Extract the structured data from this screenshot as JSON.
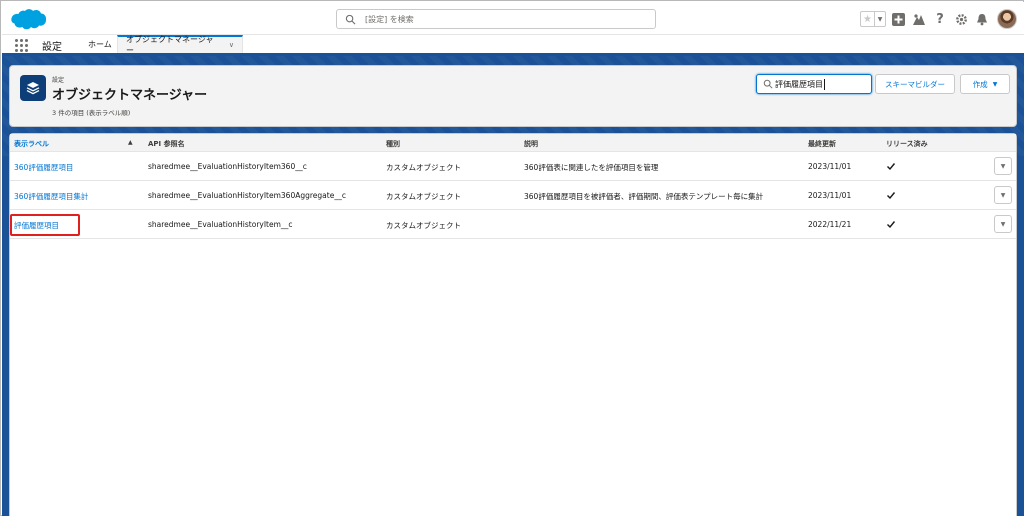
{
  "header": {
    "search_placeholder": "[設定] を検索",
    "brand_color": "#00a1e0",
    "icons": [
      "favorite-star-icon",
      "favorites-dropdown-icon",
      "add-icon",
      "trailhead-icon",
      "help-icon",
      "setup-gear-icon",
      "notifications-bell-icon",
      "user-avatar"
    ]
  },
  "context_bar": {
    "app_name": "設定",
    "tabs": [
      {
        "label": "ホーム"
      },
      {
        "label": "オブジェクトマネージャー"
      }
    ]
  },
  "page_header": {
    "breadcrumb": "設定",
    "title": "オブジェクトマネージャー",
    "meta": "3 件の項目 (表示ラベル順)",
    "quick_find_value": "評価履歴項目",
    "schema_builder_label": "スキーマビルダー",
    "create_label": "作成"
  },
  "table": {
    "columns": [
      "表示ラベル",
      "API 参照名",
      "種別",
      "説明",
      "最終更新",
      "リリース済み"
    ],
    "sorted_column": "表示ラベル",
    "rows": [
      {
        "label": "360評価履歴項目",
        "api_name": "sharedmee__EvaluationHistoryItem360__c",
        "type": "カスタムオブジェクト",
        "description": "360評価表に関連したを評価項目を管理",
        "last_modified": "2023/11/01",
        "deployed": true
      },
      {
        "label": "360評価履歴項目集計",
        "api_name": "sharedmee__EvaluationHistoryItem360Aggregate__c",
        "type": "カスタムオブジェクト",
        "description": "360評価履歴項目を被評価者、評価期間、評価表テンプレート毎に集計",
        "last_modified": "2023/11/01",
        "deployed": true
      },
      {
        "label": "評価履歴項目",
        "api_name": "sharedmee__EvaluationHistoryItem__c",
        "type": "カスタムオブジェクト",
        "description": "",
        "last_modified": "2022/11/21",
        "deployed": true
      }
    ]
  },
  "colors": {
    "accent": "#0176d3",
    "background": "#1b5297",
    "highlight": "#e0201e"
  }
}
